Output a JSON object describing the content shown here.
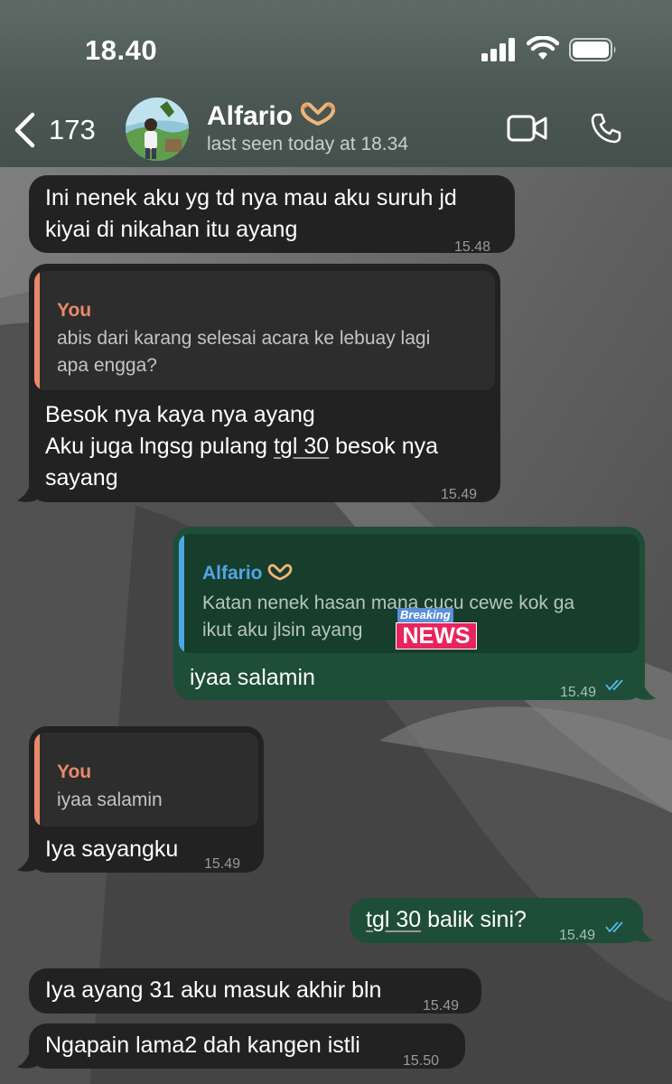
{
  "status_bar": {
    "time": "18.40"
  },
  "header": {
    "back_count": "173",
    "contact_name": "Alfario",
    "last_seen": "last seen today at 18.34"
  },
  "messages": [
    {
      "dir": "in",
      "lines": [
        "Ini nenek aku yg td nya mau aku suruh jd",
        "kiyai di nikahan itu ayang"
      ],
      "time": "15.48"
    },
    {
      "dir": "in",
      "quote_author": "You",
      "quote_lines": [
        "abis dari karang selesai acara ke lebuay lagi",
        "apa engga?"
      ],
      "lines": [
        "Besok nya kaya nya ayang",
        "Aku juga lngsg pulang ",
        "tgl 30",
        " besok nya",
        "sayang"
      ],
      "time": "15.49"
    },
    {
      "dir": "out",
      "quote_author": "Alfario",
      "quote_lines": [
        "Katan nenek hasan mana cucu cewe kok ga",
        "ikut aku jlsin ayang"
      ],
      "sticker_top": "Breaking",
      "sticker_bottom": "NEWS",
      "lines": [
        "iyaa salamin"
      ],
      "time": "15.49"
    },
    {
      "dir": "in",
      "quote_author": "You",
      "quote_lines": [
        "iyaa salamin"
      ],
      "lines": [
        "Iya sayangku"
      ],
      "time": "15.49"
    },
    {
      "dir": "out",
      "lines": [
        "tgl 30",
        " balik sini?"
      ],
      "time": "15.49"
    },
    {
      "dir": "in",
      "lines": [
        "Iya ayang 31 aku masuk akhir bln"
      ],
      "time": "15.49"
    },
    {
      "dir": "in",
      "lines": [
        "Ngapain lama2 dah kangen istli"
      ],
      "time": "15.50"
    }
  ],
  "colors": {
    "incoming": "#222222",
    "outgoing": "#1e4d38",
    "you_quote": "#e8896a",
    "alfario_quote": "#4fa6e6",
    "read_ticks": "#53bdeb"
  },
  "icons": [
    "chevron-left-icon",
    "video-camera-icon",
    "phone-icon",
    "signal-icon",
    "wifi-icon",
    "battery-icon",
    "hands-heart-emoji",
    "double-check-icon"
  ]
}
